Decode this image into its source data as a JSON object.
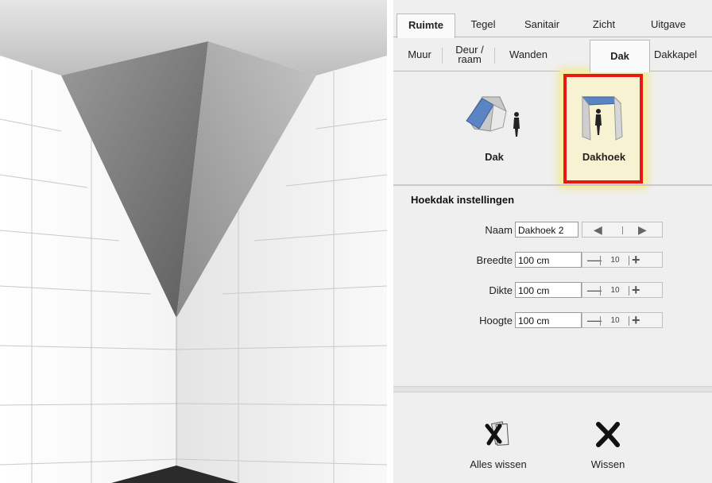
{
  "tabs_primary": [
    {
      "label": "Ruimte",
      "active": true
    },
    {
      "label": "Tegel",
      "active": false
    },
    {
      "label": "Sanitair",
      "active": false
    },
    {
      "label": "Zicht",
      "active": false
    },
    {
      "label": "Uitgave",
      "active": false
    }
  ],
  "tabs_secondary": [
    {
      "label": "Muur",
      "active": false
    },
    {
      "label": "Deur / raam",
      "active": false
    },
    {
      "label": "Wanden",
      "active": false
    },
    {
      "label": "Dak",
      "active": true
    },
    {
      "label": "Dakkapel",
      "active": false
    }
  ],
  "tools": {
    "dak": {
      "label": "Dak",
      "icon": "roof-icon"
    },
    "dakhoek": {
      "label": "Dakhoek",
      "icon": "corner-roof-icon",
      "selected": true,
      "highlight_color": "#e81818"
    }
  },
  "settings": {
    "title": "Hoekdak instellingen",
    "naam": {
      "label": "Naam",
      "value": "Dakhoek 2"
    },
    "breedte": {
      "label": "Breedte",
      "value": "100 cm",
      "step": "10"
    },
    "dikte": {
      "label": "Dikte",
      "value": "100 cm",
      "step": "10"
    },
    "hoogte": {
      "label": "Hoogte",
      "value": "100 cm",
      "step": "10"
    }
  },
  "actions": {
    "alles_wissen": {
      "label": "Alles wissen",
      "icon": "clear-all-icon"
    },
    "wissen": {
      "label": "Wissen",
      "icon": "delete-icon"
    }
  },
  "colors": {
    "panel_bg": "#efefef",
    "selection_border": "#e81818",
    "selection_glow": "#f4f0a0"
  }
}
